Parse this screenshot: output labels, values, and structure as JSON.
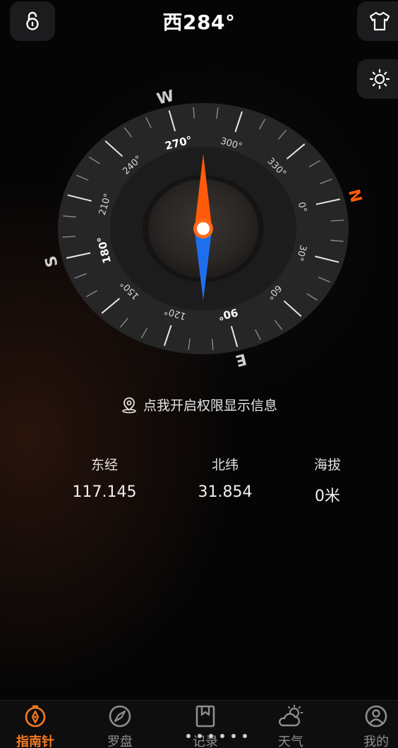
{
  "header": {
    "heading": "西284°"
  },
  "icons": {
    "lock": "unlock-icon",
    "shirt": "shirt-icon",
    "brightness": "sun-icon",
    "location": "location-pin-icon"
  },
  "compass": {
    "heading_degrees": 284,
    "cardinals": {
      "north": "N",
      "east": "E",
      "south": "S",
      "west": "W"
    },
    "degree_labels": [
      "0°",
      "30°",
      "60°",
      "90°",
      "120°",
      "150°",
      "180°",
      "210°",
      "240°",
      "270°",
      "300°",
      "330°"
    ],
    "colors": {
      "north_needle": "#ff5a0a",
      "south_needle": "#1e6ff0",
      "north_letter": "#ff5a0a"
    }
  },
  "permission_text": "点我开启权限显示信息",
  "stats": {
    "longitude": {
      "label": "东经",
      "value": "117.145"
    },
    "latitude": {
      "label": "北纬",
      "value": "31.854"
    },
    "altitude": {
      "label": "海拔",
      "value": "0米"
    }
  },
  "tabbar": {
    "active_color": "#f47b20",
    "items": [
      {
        "label": "指南针",
        "icon": "compass-tab-icon"
      },
      {
        "label": "罗盘",
        "icon": "luopan-icon"
      },
      {
        "label": "记录",
        "icon": "bookmark-icon"
      },
      {
        "label": "天气",
        "icon": "weather-icon"
      },
      {
        "label": "我的",
        "icon": "profile-icon"
      }
    ]
  }
}
